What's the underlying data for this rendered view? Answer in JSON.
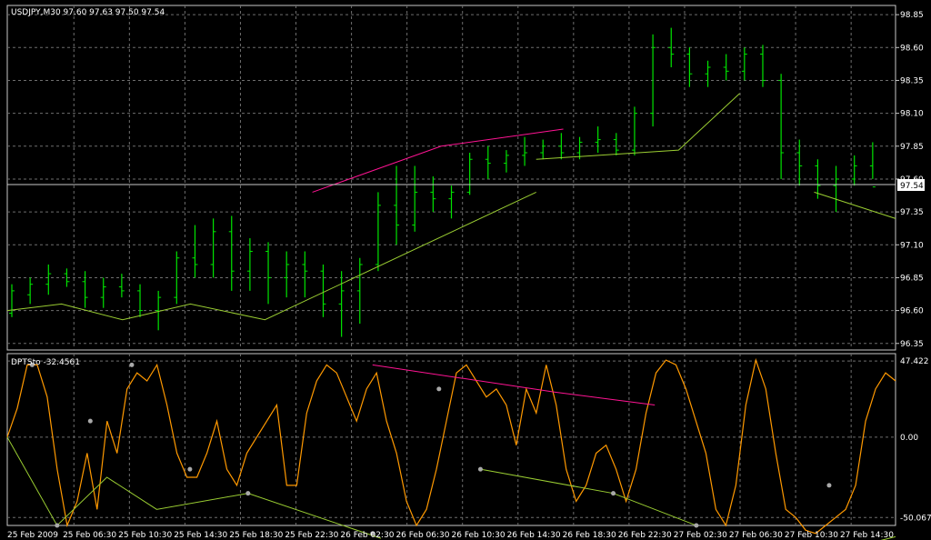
{
  "main_panel": {
    "title": "USDJPY,M30  97.60 97.63 97.50 97.54",
    "current_price": "97.54",
    "price_ticks": [
      "98.85",
      "98.60",
      "98.35",
      "98.10",
      "97.85",
      "97.60",
      "97.35",
      "97.10",
      "96.85",
      "96.60",
      "96.35"
    ]
  },
  "indicator_panel": {
    "title": "DPTSto -32.4561",
    "ticks": [
      "47.422",
      "0.00",
      "-50.0677"
    ]
  },
  "time_axis": {
    "labels": [
      "25 Feb 2009",
      "25 Feb 06:30",
      "25 Feb 10:30",
      "25 Feb 14:30",
      "25 Feb 18:30",
      "25 Feb 22:30",
      "26 Feb 02:30",
      "26 Feb 06:30",
      "26 Feb 10:30",
      "26 Feb 14:30",
      "26 Feb 18:30",
      "26 Feb 22:30",
      "27 Feb 02:30",
      "27 Feb 06:30",
      "27 Feb 10:30",
      "27 Feb 14:30"
    ]
  },
  "colors": {
    "background": "#000000",
    "grid": "#6e6e6e",
    "frame": "#c8c8c8",
    "bars": "#00e400",
    "support_line": "#9acd32",
    "resistance_line": "#ff1493",
    "oscillator": "#ff9900",
    "divergence_dot": "#a9a9a9"
  },
  "chart_data": [
    {
      "type": "ohlc",
      "title": "USDJPY,M30",
      "ylim": [
        96.3,
        98.92
      ],
      "bars": [
        {
          "o": 96.58,
          "h": 96.8,
          "l": 96.55,
          "c": 96.75
        },
        {
          "o": 96.72,
          "h": 96.85,
          "l": 96.65,
          "c": 96.8
        },
        {
          "o": 96.8,
          "h": 96.95,
          "l": 96.72,
          "c": 96.88
        },
        {
          "o": 96.88,
          "h": 96.92,
          "l": 96.78,
          "c": 96.82
        },
        {
          "o": 96.82,
          "h": 96.9,
          "l": 96.62,
          "c": 96.7
        },
        {
          "o": 96.7,
          "h": 96.85,
          "l": 96.62,
          "c": 96.78
        },
        {
          "o": 96.78,
          "h": 96.88,
          "l": 96.7,
          "c": 96.75
        },
        {
          "o": 96.75,
          "h": 96.8,
          "l": 96.55,
          "c": 96.6
        },
        {
          "o": 96.6,
          "h": 96.75,
          "l": 96.45,
          "c": 96.7
        },
        {
          "o": 96.7,
          "h": 97.05,
          "l": 96.65,
          "c": 97.0
        },
        {
          "o": 97.0,
          "h": 97.25,
          "l": 96.85,
          "c": 96.95
        },
        {
          "o": 96.95,
          "h": 97.3,
          "l": 96.85,
          "c": 97.2
        },
        {
          "o": 97.2,
          "h": 97.32,
          "l": 96.75,
          "c": 96.9
        },
        {
          "o": 96.9,
          "h": 97.15,
          "l": 96.75,
          "c": 97.05
        },
        {
          "o": 97.05,
          "h": 97.12,
          "l": 96.65,
          "c": 96.85
        },
        {
          "o": 96.85,
          "h": 97.05,
          "l": 96.7,
          "c": 96.95
        },
        {
          "o": 96.95,
          "h": 97.05,
          "l": 96.7,
          "c": 96.9
        },
        {
          "o": 96.9,
          "h": 96.95,
          "l": 96.55,
          "c": 96.65
        },
        {
          "o": 96.65,
          "h": 96.9,
          "l": 96.4,
          "c": 96.75
        },
        {
          "o": 96.75,
          "h": 97.0,
          "l": 96.5,
          "c": 96.95
        },
        {
          "o": 96.95,
          "h": 97.5,
          "l": 96.9,
          "c": 97.4
        },
        {
          "o": 97.4,
          "h": 97.7,
          "l": 97.1,
          "c": 97.25
        },
        {
          "o": 97.25,
          "h": 97.7,
          "l": 97.2,
          "c": 97.5
        },
        {
          "o": 97.5,
          "h": 97.62,
          "l": 97.35,
          "c": 97.45
        },
        {
          "o": 97.45,
          "h": 97.55,
          "l": 97.3,
          "c": 97.5
        },
        {
          "o": 97.5,
          "h": 97.8,
          "l": 97.48,
          "c": 97.75
        },
        {
          "o": 97.75,
          "h": 97.85,
          "l": 97.6,
          "c": 97.72
        },
        {
          "o": 97.72,
          "h": 97.82,
          "l": 97.65,
          "c": 97.78
        },
        {
          "o": 97.78,
          "h": 97.92,
          "l": 97.7,
          "c": 97.8
        },
        {
          "o": 97.8,
          "h": 97.9,
          "l": 97.75,
          "c": 97.85
        },
        {
          "o": 97.85,
          "h": 97.95,
          "l": 97.75,
          "c": 97.8
        },
        {
          "o": 97.8,
          "h": 97.92,
          "l": 97.75,
          "c": 97.88
        },
        {
          "o": 97.88,
          "h": 98.0,
          "l": 97.8,
          "c": 97.9
        },
        {
          "o": 97.9,
          "h": 97.95,
          "l": 97.78,
          "c": 97.82
        },
        {
          "o": 97.82,
          "h": 98.15,
          "l": 97.78,
          "c": 98.1
        },
        {
          "o": 98.1,
          "h": 98.7,
          "l": 98.0,
          "c": 98.6
        },
        {
          "o": 98.6,
          "h": 98.75,
          "l": 98.45,
          "c": 98.55
        },
        {
          "o": 98.55,
          "h": 98.6,
          "l": 98.3,
          "c": 98.4
        },
        {
          "o": 98.4,
          "h": 98.5,
          "l": 98.3,
          "c": 98.45
        },
        {
          "o": 98.45,
          "h": 98.55,
          "l": 98.35,
          "c": 98.42
        },
        {
          "o": 98.42,
          "h": 98.6,
          "l": 98.35,
          "c": 98.55
        },
        {
          "o": 98.55,
          "h": 98.62,
          "l": 98.3,
          "c": 98.35
        },
        {
          "o": 98.35,
          "h": 98.4,
          "l": 97.6,
          "c": 97.8
        },
        {
          "o": 97.8,
          "h": 97.9,
          "l": 97.55,
          "c": 97.7
        },
        {
          "o": 97.7,
          "h": 97.75,
          "l": 97.45,
          "c": 97.55
        },
        {
          "o": 97.55,
          "h": 97.7,
          "l": 97.35,
          "c": 97.6
        },
        {
          "o": 97.6,
          "h": 97.78,
          "l": 97.55,
          "c": 97.7
        },
        {
          "o": 97.7,
          "h": 97.88,
          "l": 97.6,
          "c": 97.54
        }
      ],
      "support_lines": [
        [
          [
            0,
            96.6
          ],
          [
            8,
            96.65
          ],
          [
            17,
            96.53
          ],
          [
            27,
            96.65
          ],
          [
            38,
            96.53
          ],
          [
            78,
            97.5
          ]
        ],
        [
          [
            78,
            97.75
          ],
          [
            99,
            97.82
          ],
          [
            108,
            98.25
          ]
        ],
        [
          [
            119,
            97.5
          ],
          [
            131,
            97.3
          ]
        ]
      ],
      "resistance_lines": [
        [
          [
            45,
            97.5
          ],
          [
            64,
            97.85
          ],
          [
            82,
            97.98
          ]
        ]
      ]
    },
    {
      "type": "line",
      "title": "DPTSto",
      "ylim": [
        -55,
        52
      ],
      "series": [
        {
          "values": [
            0,
            18,
            45,
            45,
            25,
            -20,
            -55,
            -40,
            -10,
            -45,
            10,
            -10,
            30,
            40,
            35,
            45,
            20,
            -10,
            -25,
            -25,
            -10,
            10,
            -20,
            -30,
            -10,
            0,
            10,
            20,
            -30,
            -30,
            15,
            35,
            45,
            40,
            25,
            10,
            30,
            40,
            10,
            -10,
            -40,
            -55,
            -45,
            -20,
            10,
            40,
            45,
            35,
            25,
            30,
            20,
            -5,
            30,
            15,
            45,
            20,
            -20,
            -40,
            -30,
            -10,
            -5,
            -20,
            -40,
            -20,
            15,
            40,
            48,
            45,
            30,
            10,
            -10,
            -45,
            -55,
            -30,
            20,
            48,
            30,
            -10,
            -45,
            -50,
            -58,
            -60,
            -55,
            -50,
            -45,
            -30,
            10,
            30,
            40,
            35
          ]
        }
      ],
      "support_lines": [
        [
          [
            0,
            0
          ],
          [
            6,
            -55
          ],
          [
            12,
            -25
          ],
          [
            18,
            -45
          ],
          [
            29,
            -35
          ],
          [
            45,
            -63
          ]
        ],
        [
          [
            57,
            -20
          ],
          [
            73,
            -35
          ],
          [
            83,
            -55
          ]
        ],
        [
          [
            97,
            -75
          ],
          [
            107,
            -62
          ]
        ]
      ],
      "resistance_lines": [
        [
          [
            44,
            45
          ],
          [
            66,
            28
          ],
          [
            78,
            20
          ]
        ]
      ]
    }
  ]
}
